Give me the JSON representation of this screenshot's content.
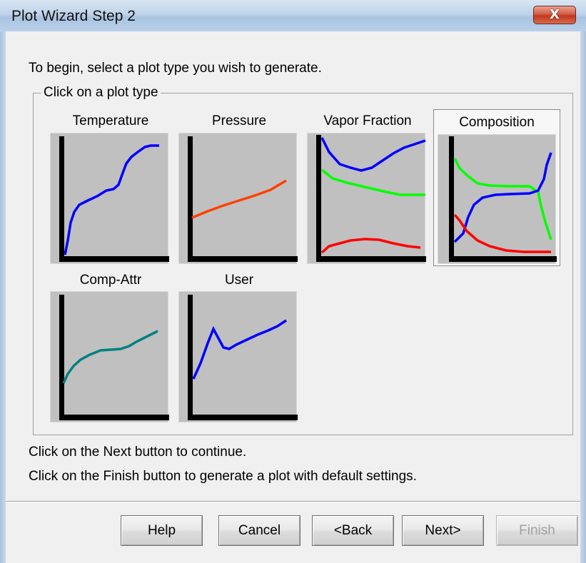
{
  "window": {
    "title": "Plot Wizard Step 2",
    "close_glyph": "X"
  },
  "instruction": "To begin, select a plot type you wish to generate.",
  "group": {
    "legend": "Click on a plot type",
    "plot_types": [
      {
        "id": "temperature",
        "label": "Temperature",
        "selected": false
      },
      {
        "id": "pressure",
        "label": "Pressure",
        "selected": false
      },
      {
        "id": "vapor-fraction",
        "label": "Vapor Fraction",
        "selected": false
      },
      {
        "id": "composition",
        "label": "Composition",
        "selected": true
      },
      {
        "id": "comp-attr",
        "label": "Comp-Attr",
        "selected": false
      },
      {
        "id": "user",
        "label": "User",
        "selected": false
      }
    ]
  },
  "hints": {
    "next": "Click on the Next button to continue.",
    "finish": "Click on the Finish button to generate a plot with default settings."
  },
  "buttons": {
    "help": "Help",
    "cancel": "Cancel",
    "back": "<Back",
    "next": "Next>",
    "finish": "Finish",
    "finish_enabled": false
  },
  "colors": {
    "thumb_background": "#c0c0c0",
    "blue": "#0000ff",
    "orange_red": "#ff4000",
    "green": "#00ff00",
    "red": "#ff0000",
    "teal": "#008080"
  }
}
